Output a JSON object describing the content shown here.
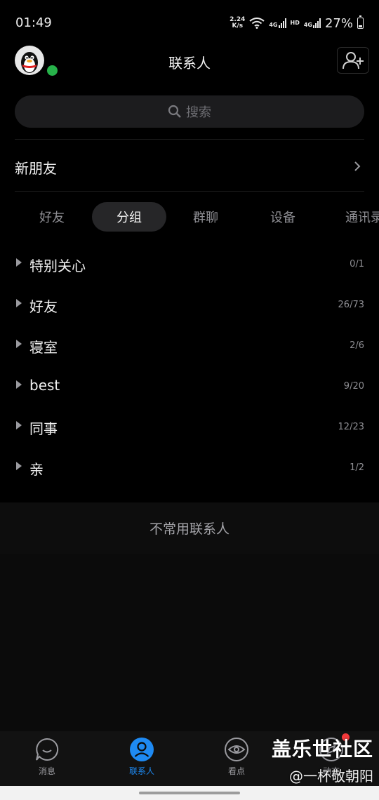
{
  "status_bar": {
    "time": "01:49",
    "net_speed_value": "2.24",
    "net_speed_unit": "K/s",
    "network_4g_1": "4G",
    "hd": "HD",
    "network_4g_2": "4G",
    "battery_percent": "27%",
    "battery_level": 0.27
  },
  "header": {
    "title": "联系人",
    "avatar_icon": "qq-penguin-avatar",
    "online_status_color": "#27b24a",
    "add_friend_icon": "add-user-icon"
  },
  "search": {
    "placeholder": "搜索"
  },
  "new_friends": {
    "label": "新朋友"
  },
  "tabs": [
    {
      "label": "好友",
      "active": false
    },
    {
      "label": "分组",
      "active": true
    },
    {
      "label": "群聊",
      "active": false
    },
    {
      "label": "设备",
      "active": false
    },
    {
      "label": "通讯录",
      "active": false
    }
  ],
  "groups": [
    {
      "name": "特别关心",
      "count": "0/1"
    },
    {
      "name": "好友",
      "count": "26/73"
    },
    {
      "name": "寝室",
      "count": "2/6"
    },
    {
      "name": "best",
      "count": "9/20"
    },
    {
      "name": "同事",
      "count": "12/23"
    },
    {
      "name": "亲",
      "count": "1/2"
    }
  ],
  "uncommon_contacts": {
    "label": "不常用联系人"
  },
  "bottom_nav": {
    "items": [
      {
        "label": "消息",
        "icon": "message-bubble-icon",
        "active": false
      },
      {
        "label": "联系人",
        "icon": "contacts-person-icon",
        "active": true
      },
      {
        "label": "看点",
        "icon": "eye-icon",
        "active": false
      },
      {
        "label": "动态",
        "icon": "compass-icon",
        "active": false
      }
    ],
    "active_color": "#1e8af3"
  },
  "watermark": {
    "line1": "盖乐世社区",
    "line2": "@一杯敬朝阳"
  }
}
